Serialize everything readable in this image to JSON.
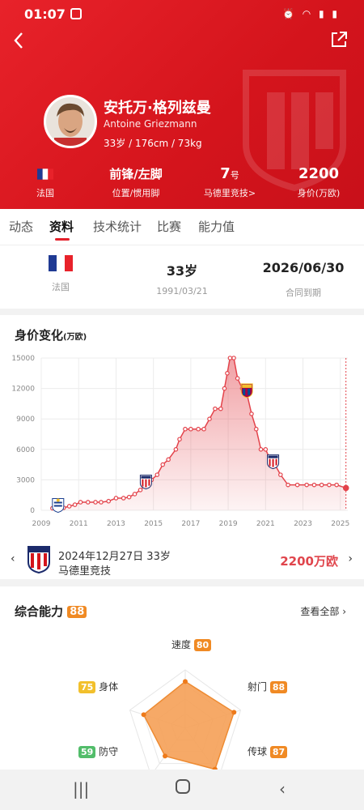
{
  "status": {
    "time": "01:07"
  },
  "player": {
    "name_cn": "安托万·格列兹曼",
    "name_en": "Antoine Griezmann",
    "meta": "33岁 / 176cm / 73kg"
  },
  "stats": [
    {
      "value": "",
      "label": "法国"
    },
    {
      "value": "前锋/左脚",
      "label": "位置/惯用脚"
    },
    {
      "value": "7",
      "unit": "号",
      "label": "马德里竞技>"
    },
    {
      "value": "2200",
      "label": "身价(万欧)"
    }
  ],
  "tabs": [
    "动态",
    "资料",
    "技术统计",
    "比赛",
    "能力值"
  ],
  "info": [
    {
      "value": "",
      "label": "法国"
    },
    {
      "value": "33岁",
      "label": "1991/03/21"
    },
    {
      "value": "2026/06/30",
      "label": "合同到期"
    }
  ],
  "value_card": {
    "title": "身价变化",
    "unit": "(万欧)"
  },
  "chart_data": {
    "type": "area",
    "x_ticks": [
      "2009",
      "2011",
      "2013",
      "2015",
      "2017",
      "2019",
      "2021",
      "2023",
      "2025"
    ],
    "y_ticks": [
      "0",
      "3000",
      "6000",
      "9000",
      "12000",
      "15000"
    ],
    "ylim": [
      0,
      15000
    ],
    "xlim": [
      2009,
      2025.4
    ],
    "points": [
      [
        2009.6,
        200
      ],
      [
        2009.9,
        200
      ],
      [
        2010.2,
        250
      ],
      [
        2010.5,
        400
      ],
      [
        2010.8,
        550
      ],
      [
        2011.1,
        800
      ],
      [
        2011.5,
        800
      ],
      [
        2011.9,
        800
      ],
      [
        2012.2,
        800
      ],
      [
        2012.6,
        900
      ],
      [
        2013.0,
        1200
      ],
      [
        2013.4,
        1200
      ],
      [
        2013.7,
        1300
      ],
      [
        2014.0,
        1600
      ],
      [
        2014.3,
        2000
      ],
      [
        2014.6,
        2500
      ],
      [
        2014.9,
        3000
      ],
      [
        2015.2,
        3500
      ],
      [
        2015.5,
        4500
      ],
      [
        2015.8,
        5000
      ],
      [
        2016.2,
        6000
      ],
      [
        2016.4,
        7000
      ],
      [
        2016.7,
        8000
      ],
      [
        2017.0,
        8000
      ],
      [
        2017.4,
        8000
      ],
      [
        2017.7,
        8000
      ],
      [
        2018.0,
        9000
      ],
      [
        2018.3,
        10000
      ],
      [
        2018.6,
        10000
      ],
      [
        2018.8,
        12000
      ],
      [
        2018.95,
        13500
      ],
      [
        2019.1,
        15000
      ],
      [
        2019.3,
        15000
      ],
      [
        2019.5,
        13000
      ],
      [
        2019.75,
        12000
      ],
      [
        2020.0,
        11500
      ],
      [
        2020.25,
        9500
      ],
      [
        2020.5,
        8000
      ],
      [
        2020.75,
        6000
      ],
      [
        2021.0,
        6000
      ],
      [
        2021.25,
        5000
      ],
      [
        2021.5,
        4500
      ],
      [
        2021.8,
        3500
      ],
      [
        2022.2,
        2500
      ],
      [
        2022.7,
        2500
      ],
      [
        2023.2,
        2500
      ],
      [
        2023.6,
        2500
      ],
      [
        2024.0,
        2500
      ],
      [
        2024.4,
        2500
      ],
      [
        2024.8,
        2500
      ],
      [
        2025.3,
        2200
      ]
    ],
    "fill_color": "#e3434b"
  },
  "transfer": {
    "date": "2024年12月27日 33岁",
    "team": "马德里竞技",
    "value": "2200万欧"
  },
  "ability": {
    "title": "综合能力",
    "score": "88",
    "view_all": "查看全部",
    "items": [
      {
        "name": "速度",
        "score": "80"
      },
      {
        "name": "射门",
        "score": "88"
      },
      {
        "name": "传球",
        "score": "87"
      },
      {
        "name": "防守",
        "score": "59"
      },
      {
        "name": "身体",
        "score": "75"
      }
    ]
  }
}
